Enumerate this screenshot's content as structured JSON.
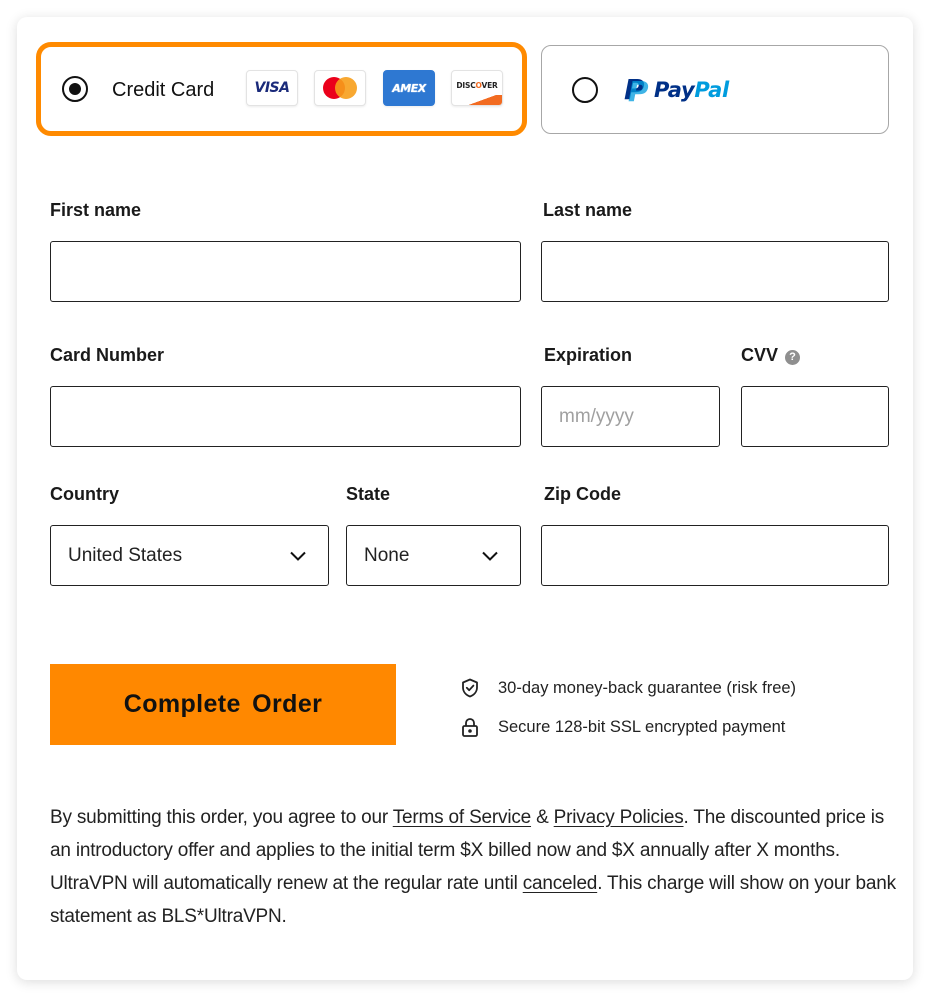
{
  "payment_methods": {
    "credit_card": {
      "label": "Credit Card",
      "selected": true,
      "brands": [
        "VISA",
        "mastercard",
        "AMEX",
        "DISCOVER"
      ],
      "visa_text": "VISA",
      "amex_text": "AMEX",
      "discover_text_pre": "DISC",
      "discover_text_o": "O",
      "discover_text_post": "VER",
      "accent_color": "#ff8a00"
    },
    "paypal": {
      "selected": false,
      "logo_mark": "P",
      "logo_pay": "Pay",
      "logo_pal": "Pal"
    }
  },
  "form": {
    "first_name": {
      "label": "First name",
      "value": ""
    },
    "last_name": {
      "label": "Last name",
      "value": ""
    },
    "card_number": {
      "label": "Card Number",
      "value": ""
    },
    "expiration": {
      "label": "Expiration",
      "placeholder": "mm/yyyy",
      "value": ""
    },
    "cvv": {
      "label": "CVV",
      "help_icon": "?",
      "value": ""
    },
    "country": {
      "label": "Country",
      "selected": "United States"
    },
    "state": {
      "label": "State",
      "selected": "None"
    },
    "zip": {
      "label": "Zip Code",
      "value": ""
    }
  },
  "order": {
    "button_label": "Complete Order",
    "button_color": "#ff8800",
    "assurances": [
      {
        "icon": "shield-check-icon",
        "text": "30-day money-back guarantee (risk free)"
      },
      {
        "icon": "lock-icon",
        "text": "Secure 128-bit SSL encrypted payment"
      }
    ]
  },
  "legal": {
    "p1": "By submitting this order, you agree to our ",
    "terms_link": "Terms of Service",
    "amp": " & ",
    "privacy_link": "Privacy Policies",
    "p2": ". The discounted price is an introductory offer and applies to the initial term $X billed now and $X annually after X months. UltraVPN will automatically renew at the regular rate until ",
    "canceled_link": "canceled",
    "p3": ". This charge will show on your bank statement as BLS*UltraVPN."
  }
}
